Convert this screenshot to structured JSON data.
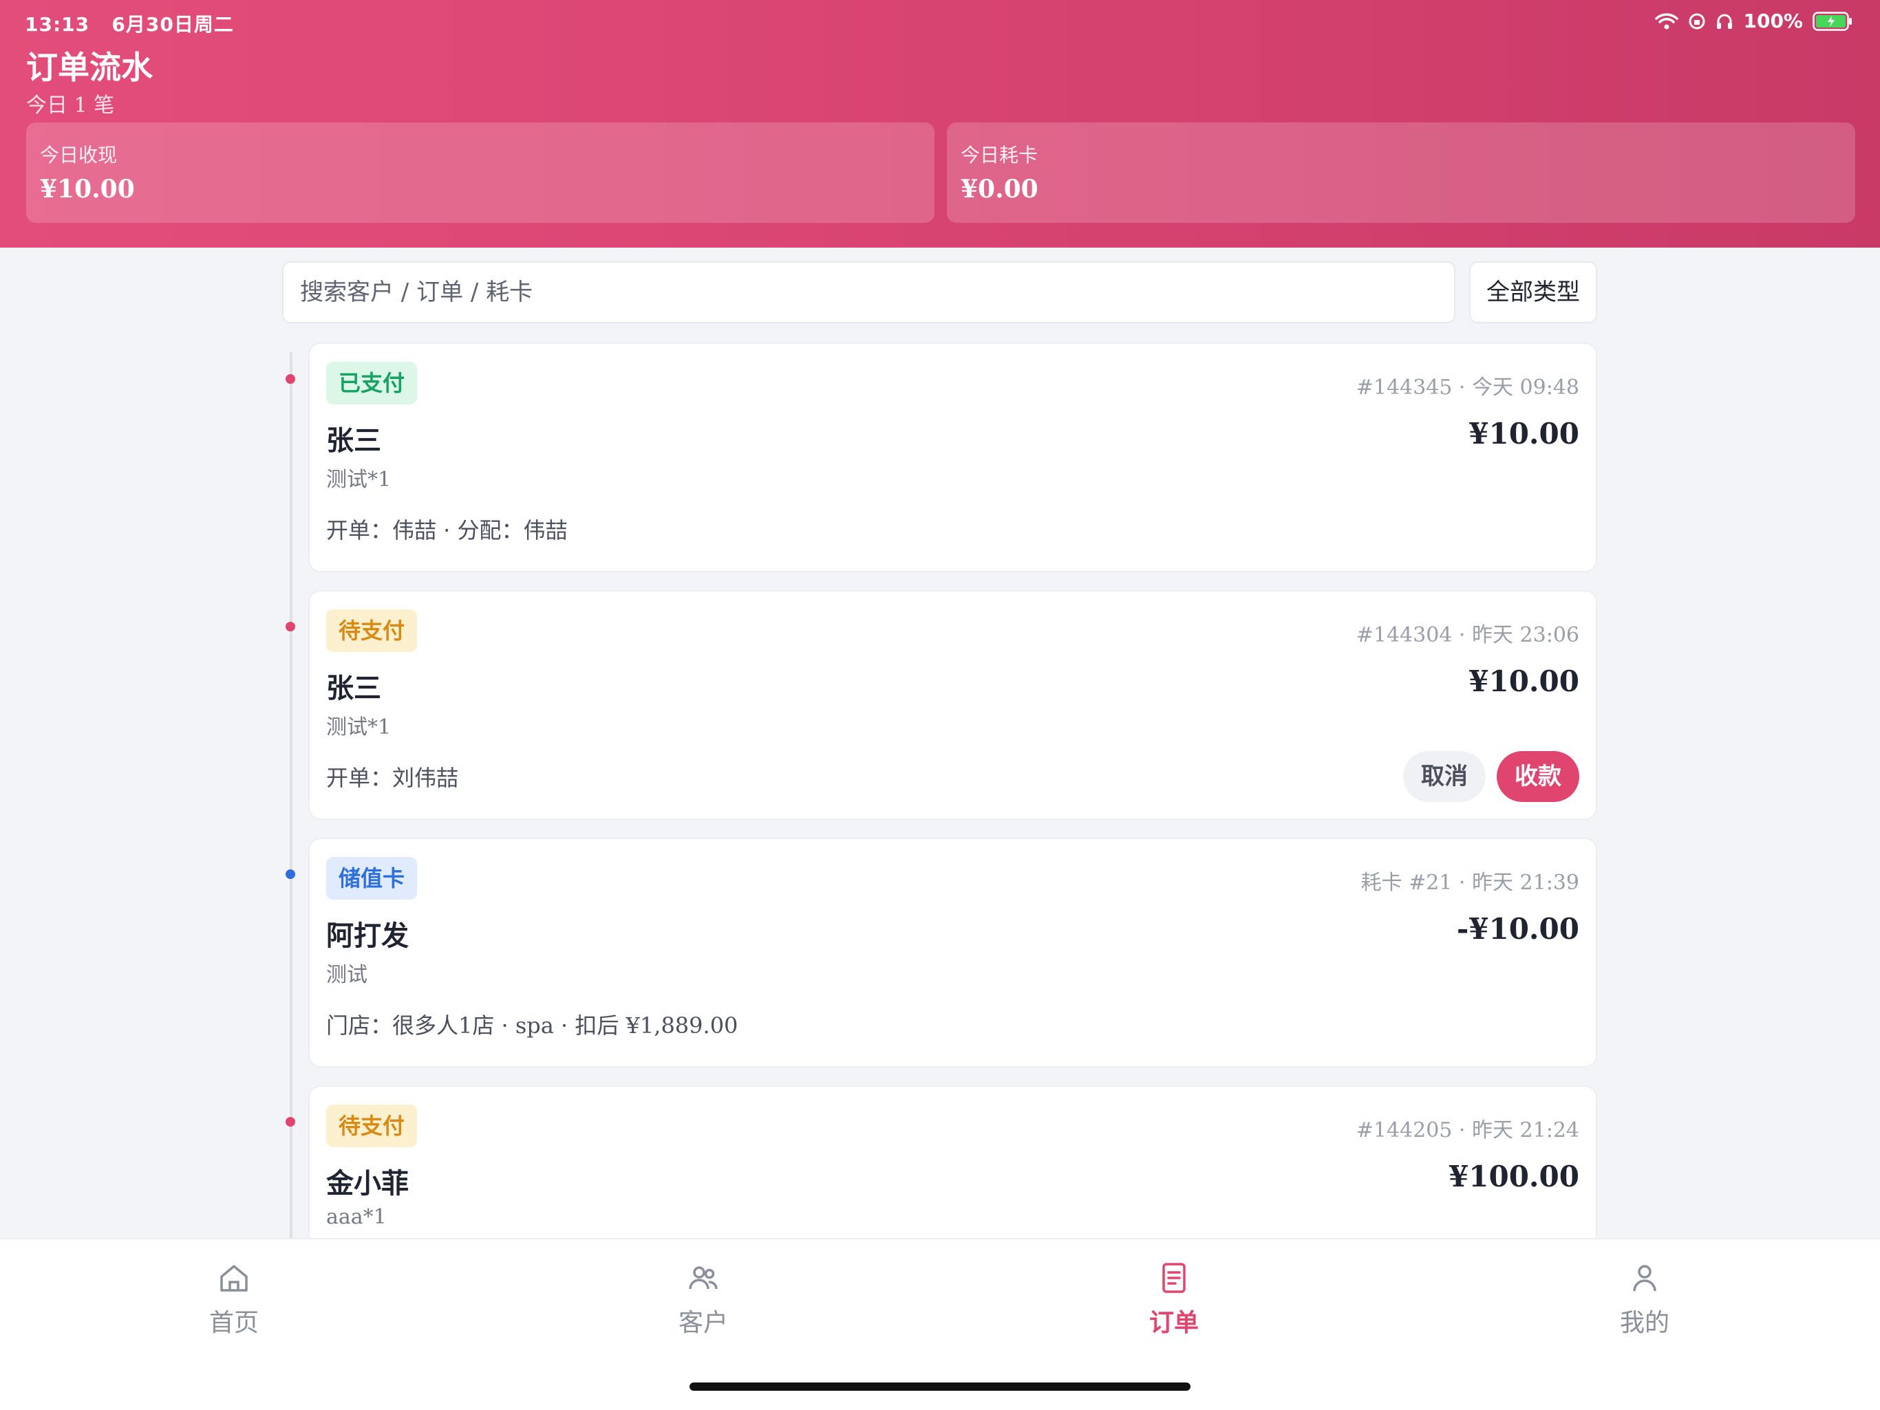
{
  "status_bar": {
    "time": "13:13",
    "date": "6月30日周二",
    "battery": "100%"
  },
  "header": {
    "title": "订单流水",
    "subtitle": "今日 1 笔",
    "stats": [
      {
        "label": "今日收现",
        "value": "¥10.00"
      },
      {
        "label": "今日耗卡",
        "value": "¥0.00"
      }
    ]
  },
  "search": {
    "placeholder": "搜索客户 / 订单 / 耗卡",
    "filter_label": "全部类型"
  },
  "orders": [
    {
      "status": "已支付",
      "status_type": "paid",
      "meta": "#144345 · 今天 09:48",
      "customer": "张三",
      "amount": "¥10.00",
      "item": "测试*1",
      "detail": "开单：伟喆 · 分配：伟喆",
      "dot_color": "#e0456f"
    },
    {
      "status": "待支付",
      "status_type": "pending",
      "meta": "#144304 · 昨天 23:06",
      "customer": "张三",
      "amount": "¥10.00",
      "item": "测试*1",
      "detail": "开单：刘伟喆",
      "actions": {
        "cancel": "取消",
        "collect": "收款"
      },
      "dot_color": "#e0456f"
    },
    {
      "status": "储值卡",
      "status_type": "stored",
      "meta": "耗卡 #21 · 昨天 21:39",
      "customer": "阿打发",
      "amount": "-¥10.00",
      "item": "测试",
      "detail": "门店：很多人1店 · spa · 扣后 ¥1,889.00",
      "dot_color": "#2f6fdb"
    },
    {
      "status": "待支付",
      "status_type": "pending",
      "meta": "#144205 · 昨天 21:24",
      "customer": "金小菲",
      "amount": "¥100.00",
      "item": "aaa*1",
      "dot_color": "#e0456f"
    }
  ],
  "tabs": [
    {
      "label": "首页",
      "icon": "home-icon"
    },
    {
      "label": "客户",
      "icon": "customers-icon"
    },
    {
      "label": "订单",
      "icon": "orders-icon",
      "active": true
    },
    {
      "label": "我的",
      "icon": "profile-icon"
    }
  ],
  "colors": {
    "brand": "#e0456f",
    "paid": "#16a362",
    "pending": "#d98a12",
    "stored": "#2f6fdb"
  }
}
